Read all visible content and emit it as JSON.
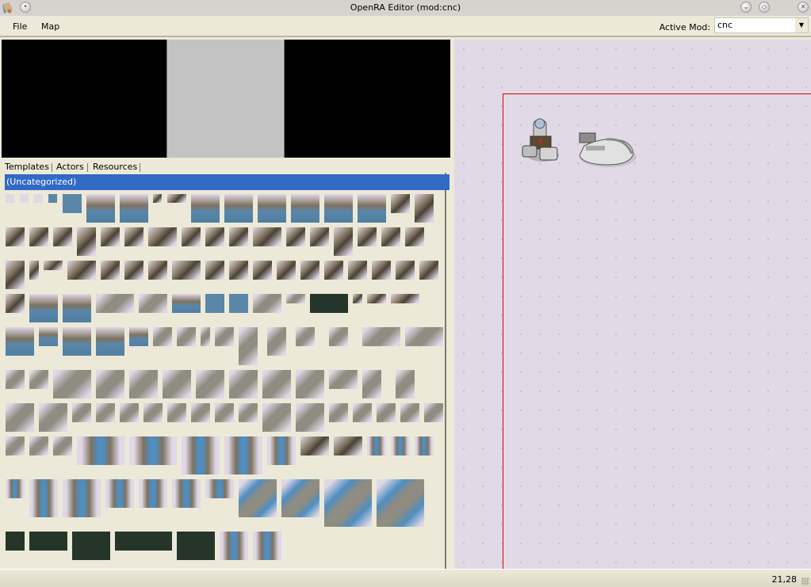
{
  "window": {
    "title": "OpenRA Editor (mod:cnc)",
    "controls": [
      "minimize",
      "maximize",
      "close"
    ]
  },
  "menubar": {
    "items": [
      {
        "label": "File"
      },
      {
        "label": "Map"
      }
    ],
    "active_mod_label": "Active Mod:",
    "active_mod_value": "cnc"
  },
  "palette": {
    "tabs": [
      {
        "label": "Templates",
        "selected": true
      },
      {
        "label": "Actors",
        "selected": false
      },
      {
        "label": "Resources",
        "selected": false
      }
    ],
    "category": "(Uncategorized)"
  },
  "canvas": {
    "actors": [
      {
        "name": "hand-of-nod"
      },
      {
        "name": "airstrip"
      }
    ],
    "colors": {
      "bounds": "#e00000",
      "ground": "#e1d9e5"
    }
  },
  "status": {
    "coords": "21,28"
  }
}
